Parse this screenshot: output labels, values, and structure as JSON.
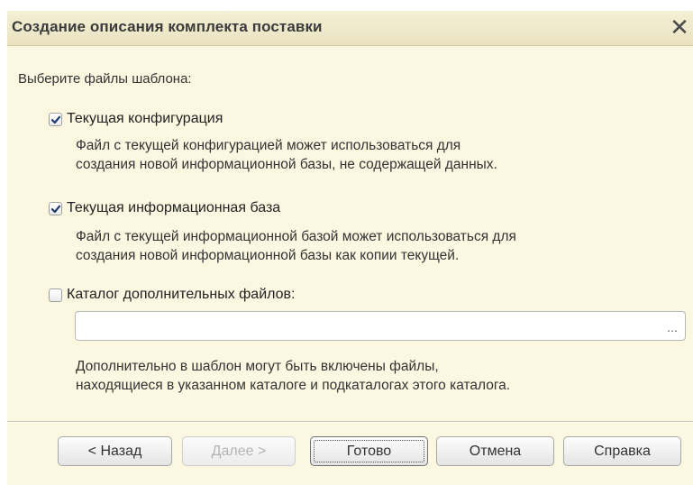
{
  "window": {
    "title": "Создание описания комплекта поставки",
    "close_symbol": "✕"
  },
  "prompt": "Выберите файлы шаблона:",
  "options": [
    {
      "label": "Текущая конфигурация",
      "checked": true,
      "description_lines": [
        "Файл с текущей конфигурацией может использоваться для",
        "создания новой информационной базы, не содержащей данных."
      ]
    },
    {
      "label": "Текущая информационная база",
      "checked": true,
      "description_lines": [
        "Файл с текущей информационной базой может использоваться для",
        "создания новой информационной базы как копии текущей."
      ]
    },
    {
      "label": "Каталог дополнительных файлов:",
      "checked": false,
      "path_value": "",
      "browse_label": "...",
      "description_lines": [
        "Дополнительно в шаблон могут быть включены файлы,",
        "находящиеся в указанном каталоге и подкаталогах этого каталога."
      ]
    }
  ],
  "buttons": {
    "back": "< Назад",
    "next": "Далее >",
    "finish": "Готово",
    "cancel": "Отмена",
    "help": "Справка"
  },
  "colors": {
    "dialog_bg": "#fbf7e1",
    "title_text": "#3b3b3b",
    "check_mark": "#1f3b6e"
  }
}
